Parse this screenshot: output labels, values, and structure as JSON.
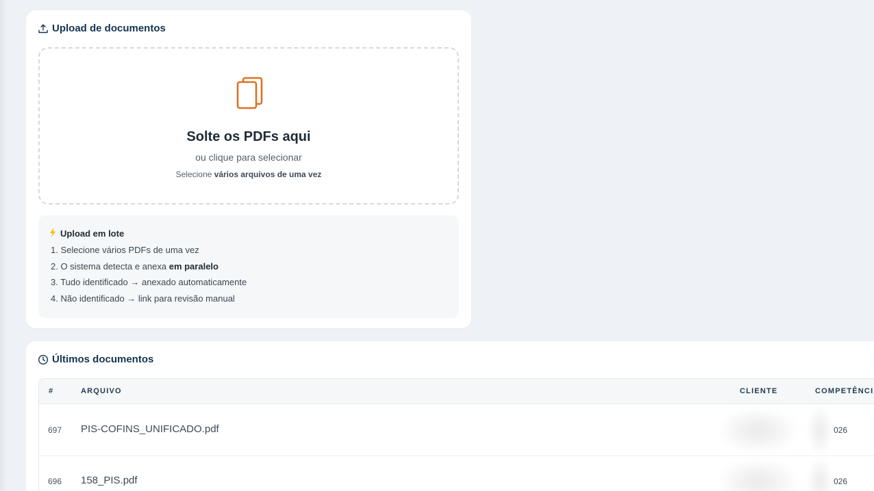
{
  "upload": {
    "title": "Upload de documentos",
    "dropzone": {
      "title": "Solte os PDFs aqui",
      "subtitle": "ou clique para selecionar",
      "hint_prefix": "Selecione ",
      "hint_bold": "vários arquivos de uma vez",
      "icon": "files-icon"
    },
    "batch": {
      "title": "Upload em lote",
      "icon": "lightning-icon",
      "steps": [
        {
          "text": "1. Selecione vários PDFs de uma vez",
          "bold": ""
        },
        {
          "text": "2. O sistema detecta e anexa ",
          "bold": "em paralelo"
        },
        {
          "text": "3. Tudo identificado → anexado automaticamente",
          "bold": ""
        },
        {
          "text": "4. Não identificado → link para revisão manual",
          "bold": ""
        }
      ]
    }
  },
  "recent": {
    "title": "Últimos documentos",
    "columns": {
      "num": "#",
      "file": "ARQUIVO",
      "client": "CLIENTE",
      "competence": "COMPETÊNCI"
    },
    "rows": [
      {
        "num": "697",
        "file": "PIS-COFINS_UNIFICADO.pdf",
        "competence": "026"
      },
      {
        "num": "696",
        "file": "158_PIS.pdf",
        "competence": "026"
      }
    ]
  },
  "colors": {
    "accent": "#e07020",
    "title": "#14344f",
    "background": "#eef2f6",
    "lightning": "#f2c200"
  }
}
